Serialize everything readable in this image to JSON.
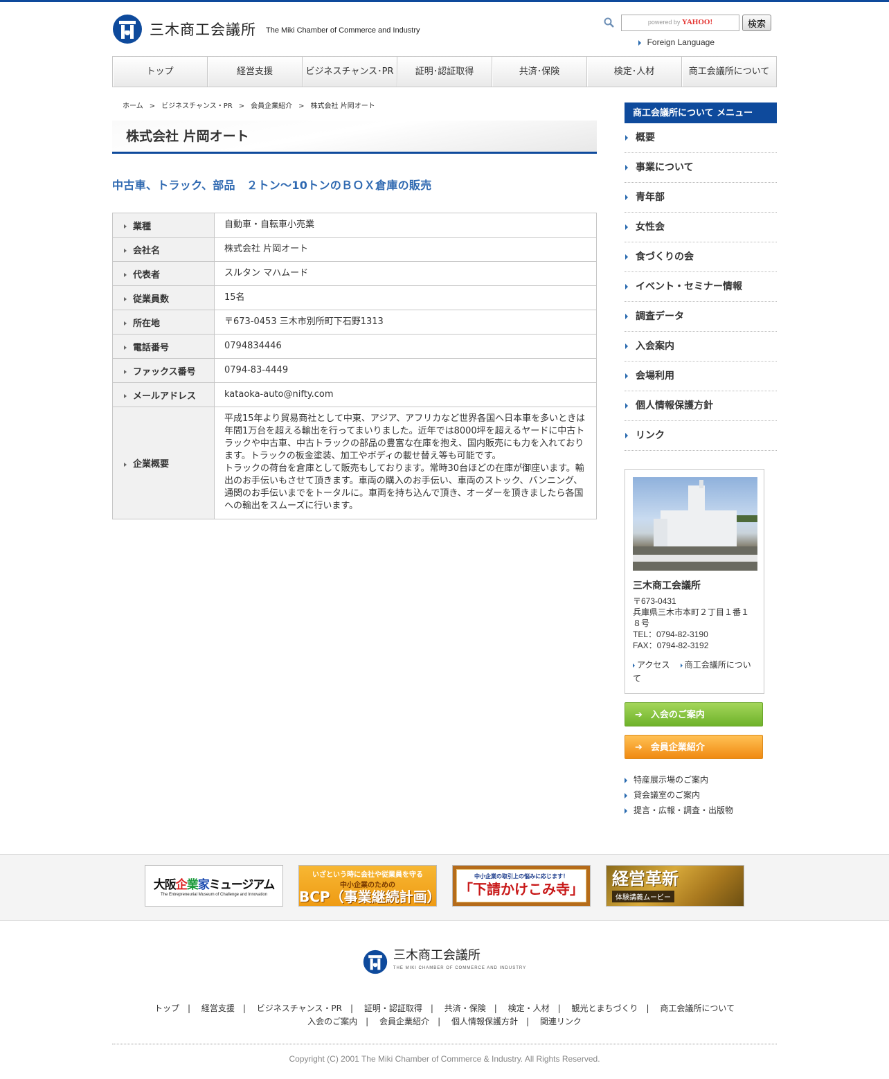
{
  "header": {
    "logo_jp": "三木商工会議所",
    "logo_en": "The Miki Chamber of Commerce and Industry",
    "search_powered": "powered by",
    "search_brand": "YAHOO!",
    "search_button": "検索",
    "foreign_language": "Foreign Language"
  },
  "nav": [
    "トップ",
    "経営支援",
    "ビジネスチャンス･PR",
    "証明･認証取得",
    "共済･保険",
    "検定･人材",
    "商工会議所について"
  ],
  "breadcrumb": [
    "ホーム",
    "ビジネスチャンス・PR",
    "会員企業紹介",
    "株式会社 片岡オート"
  ],
  "page_title": "株式会社 片岡オート",
  "lead": "中古車、トラック、部品　２トン～10トンのＢＯＸ倉庫の販売",
  "info": [
    {
      "label": "業種",
      "value": "自動車・自転車小売業"
    },
    {
      "label": "会社名",
      "value": "株式会社 片岡オート"
    },
    {
      "label": "代表者",
      "value": "スルタン マハムード"
    },
    {
      "label": "従業員数",
      "value": "15名"
    },
    {
      "label": "所在地",
      "value": "〒673-0453 三木市別所町下石野1313"
    },
    {
      "label": "電話番号",
      "value": "0794834446"
    },
    {
      "label": "ファックス番号",
      "value": "0794-83-4449"
    },
    {
      "label": "メールアドレス",
      "value": "kataoka-auto@nifty.com"
    },
    {
      "label": "企業概要",
      "value": "平成15年より貿易商社として中東、アジア、アフリカなど世界各国へ日本車を多いときは年間1万台を超える輸出を行ってまいりました。近年では8000坪を超えるヤードに中古トラックや中古車、中古トラックの部品の豊富な在庫を抱え、国内販売にも力を入れております。トラックの板金塗装、加工やボディの載せ替え等も可能です。",
      "value2": "トラックの荷台を倉庫として販売もしております。常時30台ほどの在庫が御座います。輸出のお手伝いもさせて頂きます。車両の購入のお手伝い、車両のストック、バンニング、通関のお手伝いまでをトータルに。車両を持ち込んで頂き、オーダーを頂きましたら各国への輸出をスムーズに行います。"
    }
  ],
  "side": {
    "heading": "商工会議所について メニュー",
    "menu": [
      "概要",
      "事業について",
      "青年部",
      "女性会",
      "食づくりの会",
      "イベント・セミナー情報",
      "調査データ",
      "入会案内",
      "会場利用",
      "個人情報保護方針",
      "リンク"
    ],
    "office_name": "三木商工会議所",
    "postal": "〒673-0431",
    "address": "兵庫県三木市本町２丁目１番１８号",
    "tel": "TEL：0794-82-3190",
    "fax": "FAX：0794-82-3192",
    "link_access": "アクセス",
    "link_about": "商工会議所について",
    "cta_join": "入会のご案内",
    "cta_members": "会員企業紹介",
    "sub_links": [
      "特産展示場のご案内",
      "貸会議室のご案内",
      "提言・広報・調査・出版物"
    ]
  },
  "banners": {
    "b1_title_a": "大阪",
    "b1_title_b": "企",
    "b1_title_c": "業",
    "b1_title_d": "家",
    "b1_title_e": "ミュージアム",
    "b1_sub": "The Entrepreneurial Museum of Challenge and Innovation",
    "b2_a": "いざという時に会社や従業員を守る",
    "b2_b": "中小企業のための",
    "b2_c": "BCP（事業継続計画）",
    "b3_a": "中小企業の取引上の悩みに応じます！",
    "b3_c": "「下請かけこみ寺」",
    "b4_c": "経営革新",
    "b4_a": "体験講義ムービー"
  },
  "footer": {
    "logo_jp": "三木商工会議所",
    "logo_en": "THE MIKI CHAMBER OF COMMERCE AND INDUSTRY",
    "links_row1": [
      "トップ",
      "経営支援",
      "ビジネスチャンス・PR",
      "証明・認証取得",
      "共済・保険",
      "検定・人材",
      "観光とまちづくり",
      "商工会議所について"
    ],
    "links_row2": [
      "入会のご案内",
      "会員企業紹介",
      "個人情報保護方針",
      "関連リンク"
    ],
    "copyright": "Copyright (C) 2001 The Miki Chamber of Commerce & Industry. All Rights Reserved."
  },
  "colors": {
    "brand_blue": "#0e4a9c",
    "lead_blue": "#2f69b1",
    "cta_green": "#6eb22a",
    "cta_orange": "#f08a12"
  }
}
